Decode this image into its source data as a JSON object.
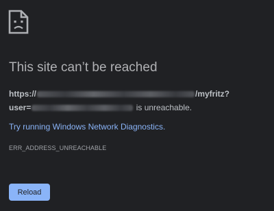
{
  "page": {
    "icon": "broken-page-icon",
    "title": "This site can’t be reached",
    "url_prefix": "https://",
    "url_suffix": "/myfritz?",
    "user_prefix": "user=",
    "unreachable_text": " is unreachable.",
    "diagnostics_link": "Try running Windows Network Diagnostics.",
    "error_code": "ERR_ADDRESS_UNREACHABLE",
    "reload_label": "Reload"
  },
  "colors": {
    "background": "#202124",
    "title": "#b0b1b4",
    "text": "#bdc1c6",
    "link": "#8ab4f8",
    "button": "#8ab4f8"
  }
}
